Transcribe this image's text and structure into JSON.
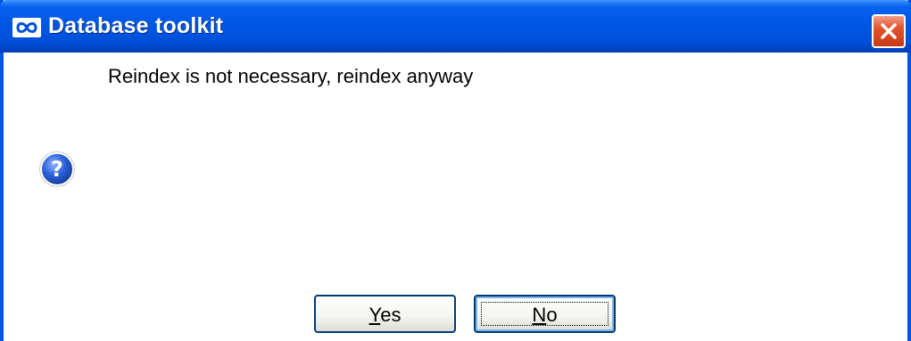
{
  "window": {
    "title": "Database toolkit",
    "app_icon": "infinity-logo-icon",
    "close_icon": "close-icon"
  },
  "dialog": {
    "message": "Reindex is not necessary, reindex anyway",
    "icon": "question-icon"
  },
  "buttons": {
    "yes": {
      "mnemonic": "Y",
      "rest": "es"
    },
    "no": {
      "mnemonic": "N",
      "rest": "o"
    }
  },
  "colors": {
    "titlebar": "#0054e3",
    "close_button": "#e2522d"
  }
}
